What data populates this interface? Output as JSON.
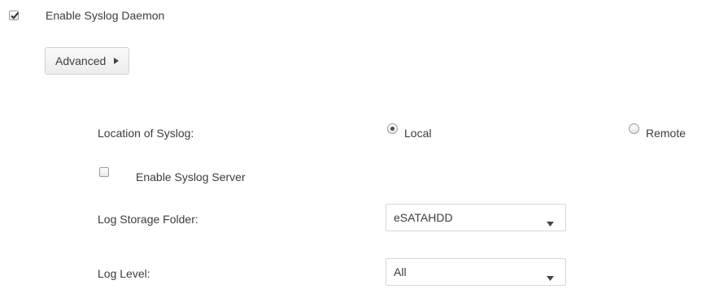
{
  "syslog": {
    "enable_daemon": {
      "label": "Enable Syslog Daemon",
      "checked": true
    },
    "advanced_button": {
      "label": "Advanced"
    },
    "location": {
      "label": "Location of Syslog:",
      "options": [
        {
          "label": "Local",
          "selected": true
        },
        {
          "label": "Remote",
          "selected": false
        }
      ]
    },
    "enable_server": {
      "label": "Enable Syslog Server",
      "checked": false
    },
    "storage_folder": {
      "label": "Log Storage Folder:",
      "value": "eSATAHDD"
    },
    "log_level": {
      "label": "Log Level:",
      "value": "All"
    }
  },
  "icons": {
    "checkmark": "checkmark-icon",
    "advanced_caret": "caret-right-icon",
    "dropdown_arrow": "chevron-down-icon"
  }
}
